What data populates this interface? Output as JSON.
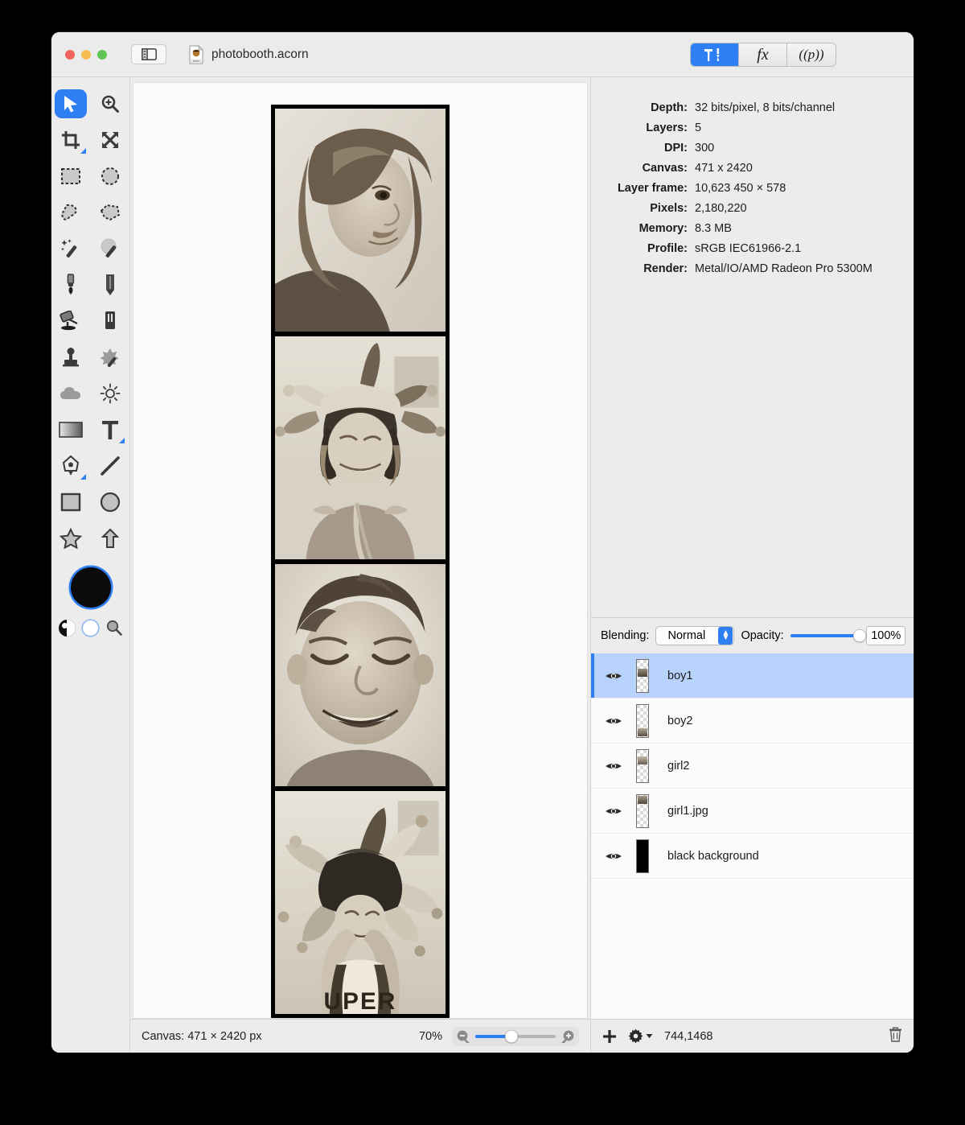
{
  "window": {
    "title": "photobooth.acorn",
    "traffic_lights": [
      "close",
      "minimize",
      "zoom"
    ],
    "sidebar_toggle_icon": "sidebar-toggle-icon",
    "doc_icon": "acorn-document-icon"
  },
  "segmented_control": {
    "items": [
      {
        "id": "tools",
        "label": "",
        "icon": "hammer-pen-icon",
        "active": true
      },
      {
        "id": "filters",
        "label": "fx",
        "icon": "fx-icon",
        "active": false
      },
      {
        "id": "presets",
        "label": "((p))",
        "icon": "palette-icon",
        "active": false
      }
    ]
  },
  "tools": {
    "items": [
      {
        "name": "move-tool",
        "icon": "arrow-cursor-icon",
        "selected": true,
        "corner": false
      },
      {
        "name": "zoom-tool",
        "icon": "magnifier-plus-icon",
        "selected": false,
        "corner": false
      },
      {
        "name": "crop-tool",
        "icon": "crop-icon",
        "selected": false,
        "corner": true
      },
      {
        "name": "transform-tool",
        "icon": "four-arrows-icon",
        "selected": false,
        "corner": false
      },
      {
        "name": "rectangular-select-tool",
        "icon": "marquee-rectangle-icon",
        "selected": false,
        "corner": false
      },
      {
        "name": "elliptical-select-tool",
        "icon": "marquee-ellipse-icon",
        "selected": false,
        "corner": false
      },
      {
        "name": "lasso-tool",
        "icon": "lasso-icon",
        "selected": false,
        "corner": false
      },
      {
        "name": "polygon-lasso-tool",
        "icon": "polygon-lasso-icon",
        "selected": false,
        "corner": false
      },
      {
        "name": "magic-wand-tool",
        "icon": "magic-wand-icon",
        "selected": false,
        "corner": false
      },
      {
        "name": "instant-alpha-tool",
        "icon": "magic-wand-alpha-icon",
        "selected": false,
        "corner": false
      },
      {
        "name": "paintbrush-tool",
        "icon": "paintbrush-icon",
        "selected": false,
        "corner": false
      },
      {
        "name": "pencil-tool",
        "icon": "pencil-icon",
        "selected": false,
        "corner": false
      },
      {
        "name": "paint-bucket-tool",
        "icon": "paint-bucket-icon",
        "selected": false,
        "corner": false
      },
      {
        "name": "eraser-tool",
        "icon": "eraser-icon",
        "selected": false,
        "corner": false
      },
      {
        "name": "clone-stamp-tool",
        "icon": "clone-stamp-icon",
        "selected": false,
        "corner": false
      },
      {
        "name": "smudge-tool",
        "icon": "smudge-splat-icon",
        "selected": false,
        "corner": false
      },
      {
        "name": "blur-tool",
        "icon": "cloud-icon",
        "selected": false,
        "corner": false
      },
      {
        "name": "dodge-burn-tool",
        "icon": "sun-icon",
        "selected": false,
        "corner": false
      },
      {
        "name": "gradient-tool",
        "icon": "gradient-icon",
        "selected": false,
        "corner": false
      },
      {
        "name": "text-tool",
        "icon": "text-t-icon",
        "selected": false,
        "corner": true
      },
      {
        "name": "bezier-pen-tool",
        "icon": "bezier-pen-icon",
        "selected": false,
        "corner": true
      },
      {
        "name": "line-tool",
        "icon": "line-icon",
        "selected": false,
        "corner": false
      },
      {
        "name": "rectangle-shape-tool",
        "icon": "rectangle-shape-icon",
        "selected": false,
        "corner": false
      },
      {
        "name": "ellipse-shape-tool",
        "icon": "ellipse-shape-icon",
        "selected": false,
        "corner": false
      },
      {
        "name": "star-shape-tool",
        "icon": "star-shape-icon",
        "selected": false,
        "corner": false
      },
      {
        "name": "arrow-shape-tool",
        "icon": "arrow-shape-icon",
        "selected": false,
        "corner": false
      }
    ],
    "foreground_color": "#0b0b0b",
    "background_color": "#ffffff",
    "swap_icon": "swap-colors-icon",
    "loupe_icon": "magnifier-icon"
  },
  "info": {
    "rows": [
      {
        "label": "Depth:",
        "value": "32 bits/pixel, 8 bits/channel"
      },
      {
        "label": "Layers:",
        "value": "5"
      },
      {
        "label": "DPI:",
        "value": "300"
      },
      {
        "label": "Canvas:",
        "value": "471 x 2420"
      },
      {
        "label": "Layer frame:",
        "value": "10,623 450 × 578"
      },
      {
        "label": "Pixels:",
        "value": "2,180,220"
      },
      {
        "label": "Memory:",
        "value": "8.3 MB"
      },
      {
        "label": "Profile:",
        "value": "sRGB IEC61966-2.1"
      },
      {
        "label": "Render:",
        "value": "Metal/IO/AMD Radeon Pro 5300M"
      }
    ]
  },
  "layers_panel": {
    "blending_label": "Blending:",
    "blending_value": "Normal",
    "blending_options": [
      "Normal"
    ],
    "opacity_label": "Opacity:",
    "opacity_value": "100%",
    "opacity_percent": 100,
    "layers": [
      {
        "name": "boy1",
        "visible": true,
        "selected": true,
        "thumb": "photo"
      },
      {
        "name": "boy2",
        "visible": true,
        "selected": false,
        "thumb": "photo"
      },
      {
        "name": "girl2",
        "visible": true,
        "selected": false,
        "thumb": "photo"
      },
      {
        "name": "girl1.jpg",
        "visible": true,
        "selected": false,
        "thumb": "photo"
      },
      {
        "name": "black background",
        "visible": true,
        "selected": false,
        "thumb": "black"
      }
    ],
    "footer": {
      "add_icon": "plus-icon",
      "settings_icon": "gear-dropdown-icon",
      "coordinates": "744,1468",
      "trash_icon": "trash-icon"
    }
  },
  "statusbar": {
    "canvas_size": "Canvas: 471 × 2420 px",
    "zoom_percent": "70%",
    "zoom_slider_value": 45,
    "zoom_out_icon": "magnifier-minus-icon",
    "zoom_in_icon": "magnifier-plus-icon"
  },
  "canvas": {
    "document_name": "photobooth.acorn",
    "photos": [
      {
        "id": "girl1",
        "caption": "girl smiling side profile"
      },
      {
        "id": "girl2",
        "caption": "girl laughing with jester hat"
      },
      {
        "id": "boy2",
        "caption": "boy laughing close-up"
      },
      {
        "id": "boy1",
        "caption": "boy with jester hat hands on head"
      }
    ]
  },
  "colors": {
    "accent": "#2f7ff4",
    "selection": "#b8d3fb",
    "chrome": "#ececec",
    "canvas_bg": "#fafafa",
    "strip_black": "#000000"
  }
}
